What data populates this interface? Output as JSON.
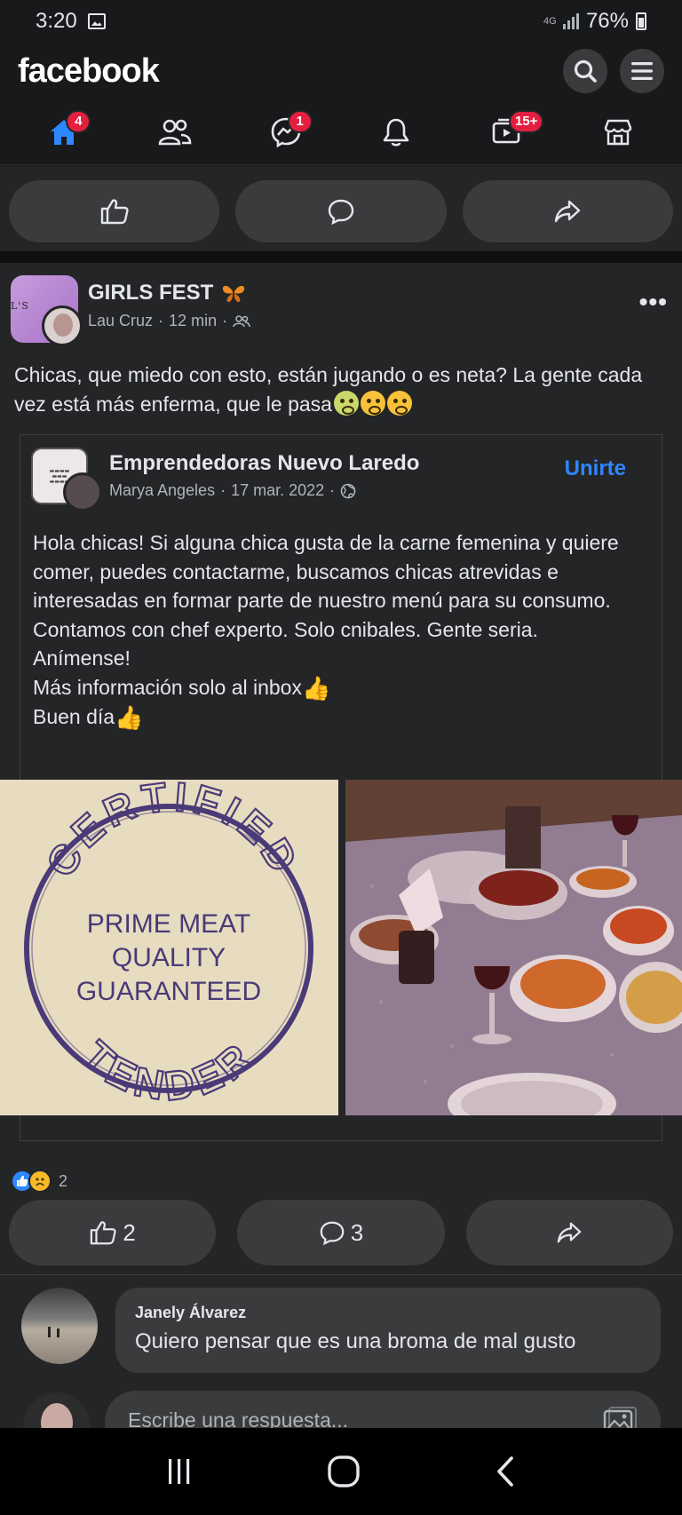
{
  "status": {
    "time": "3:20",
    "network": "4G",
    "battery": "76%"
  },
  "header": {
    "logo": "facebook"
  },
  "nav": {
    "badges": {
      "home": "4",
      "messenger": "1",
      "watch": "15+"
    }
  },
  "post": {
    "group_name": "GIRLS FEST",
    "group_avatar_text": "L'S",
    "author": "Lau Cruz",
    "time": "12 min",
    "text": "Chicas, que miedo con esto, están jugando o es neta? La gente cada vez está más enferma, que le pasa",
    "shared": {
      "group_name": "Emprendedoras Nuevo Laredo",
      "author": "Marya Angeles",
      "date": "17 mar. 2022",
      "join_label": "Unirte",
      "text": "Hola chicas! Si alguna chica gusta de la carne femenina y quiere comer, puedes contactarme, buscamos chicas atrevidas e interesadas en formar parte de nuestro menú para su consumo. Contamos con chef experto. Solo cnibales. Gente seria.\nAnímense!\nMás información solo al inbox",
      "text_end": "Buen día",
      "stamp": {
        "top": "CERTIFIED",
        "line1": "PRIME MEAT",
        "line2": "QUALITY",
        "line3": "GUARANTEED",
        "bottom": "TENDER"
      }
    },
    "reaction_count": "2",
    "like_count": "2",
    "comment_count": "3"
  },
  "comment": {
    "author": "Janely Álvarez",
    "text": "Quiero pensar que es una broma de mal gusto"
  },
  "reply": {
    "placeholder": "Escribe una respuesta..."
  },
  "colors": {
    "accent": "#2d88ff",
    "badge": "#e41e3f",
    "surface": "#242526",
    "pill": "#3a3b3c"
  }
}
